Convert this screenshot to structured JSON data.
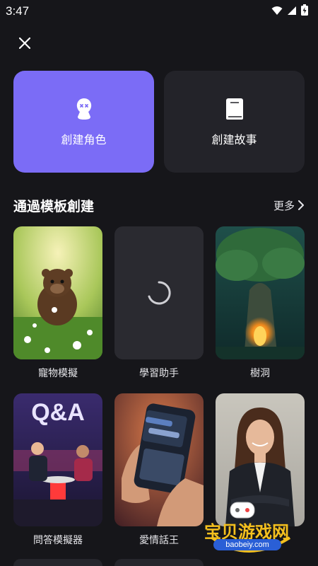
{
  "status_bar": {
    "time": "3:47"
  },
  "header": {
    "close_icon": "close-icon"
  },
  "create": {
    "character_label": "創建角色",
    "story_label": "創建故事"
  },
  "templates_section": {
    "title": "通過模板創建",
    "more_label": "更多"
  },
  "templates": [
    {
      "label": "寵物模擬",
      "icon": "pet-thumbnail"
    },
    {
      "label": "學習助手",
      "icon": "loading-spinner"
    },
    {
      "label": "樹洞",
      "icon": "tree-thumbnail"
    },
    {
      "label": "問答模擬器",
      "icon": "qa-thumbnail"
    },
    {
      "label": "愛情話王",
      "icon": "phone-chat-thumbnail"
    },
    {
      "label": "",
      "icon": "businesswoman-thumbnail"
    }
  ],
  "qa_overlay_text": "Q&A",
  "watermark": {
    "title": "宝贝游戏网",
    "url": "baobeiy.com"
  },
  "colors": {
    "background": "#16161a",
    "character_card": "#7b6cf6",
    "story_card": "#232329"
  }
}
